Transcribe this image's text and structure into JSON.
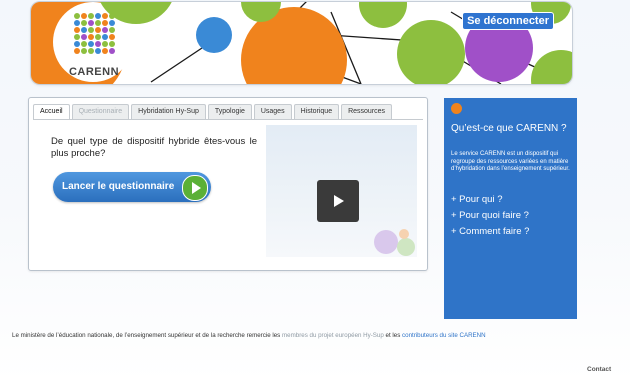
{
  "header": {
    "logout_label": "Se déconnecter",
    "logo_text": "CARENN"
  },
  "tabs": [
    {
      "label": "Accueil",
      "state": "active"
    },
    {
      "label": "Questionnaire",
      "state": "disabled"
    },
    {
      "label": "Hybridation Hy-Sup",
      "state": "normal"
    },
    {
      "label": "Typologie",
      "state": "normal"
    },
    {
      "label": "Usages",
      "state": "normal"
    },
    {
      "label": "Historique",
      "state": "normal"
    },
    {
      "label": "Ressources",
      "state": "normal"
    }
  ],
  "main": {
    "question": "De quel type de dispositif hybride êtes-vous le plus proche?",
    "start_button_label": "Lancer le questionnaire"
  },
  "info": {
    "title": "Qu’est-ce que CARENN ?",
    "description": "Le service CARENN est un dispositif qui regroupe des ressources variées en matière d’hybridation dans l’enseignement supérieur.",
    "links": [
      "+ Pour qui ?",
      "+ Pour quoi faire ?",
      "+ Comment faire ?"
    ]
  },
  "footer": {
    "text_before": "Le ministère de l’éducation nationale, de l’enseignement supérieur et de la recherche remercie les ",
    "link1": "membres du projet européen Hy-Sup",
    "text_middle": " et les ",
    "link2": "contributeurs du site CARENN",
    "contact_label": "Contact"
  },
  "colors": {
    "accent_blue": "#2f74c8",
    "orange": "#f0831d",
    "green": "#8dbf3f",
    "purple": "#a050c8",
    "play_green": "#5bb037"
  }
}
